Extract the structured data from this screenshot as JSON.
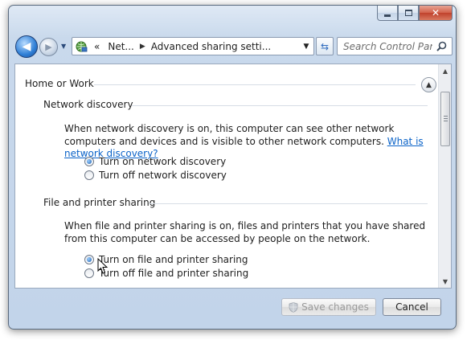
{
  "window": {
    "caption": {
      "minimize": "minimize",
      "maximize": "maximize",
      "close": "✕"
    }
  },
  "navbar": {
    "address_overflow": "«",
    "address_segments": [
      "Net...",
      "Advanced sharing setti..."
    ],
    "search_placeholder": "Search Control Panel"
  },
  "content": {
    "group_header": "Home or Work",
    "sections": [
      {
        "title": "Network discovery",
        "description": "When network discovery is on, this computer can see other network computers and devices and is visible to other network computers.",
        "link": "What is network discovery?",
        "options": [
          {
            "label": "Turn on network discovery",
            "checked": true
          },
          {
            "label": "Turn off network discovery",
            "checked": false
          }
        ]
      },
      {
        "title": "File and printer sharing",
        "description": "When file and printer sharing is on, files and printers that you have shared from this computer can be accessed by people on the network.",
        "options": [
          {
            "label": "Turn on file and printer sharing",
            "checked": true
          },
          {
            "label": "Turn off file and printer sharing",
            "checked": false
          }
        ]
      }
    ]
  },
  "footer": {
    "save_label": "Save changes",
    "cancel_label": "Cancel"
  },
  "colors": {
    "link": "#0b63c8",
    "close_button": "#c0422c",
    "back_button": "#2f7fd6"
  }
}
